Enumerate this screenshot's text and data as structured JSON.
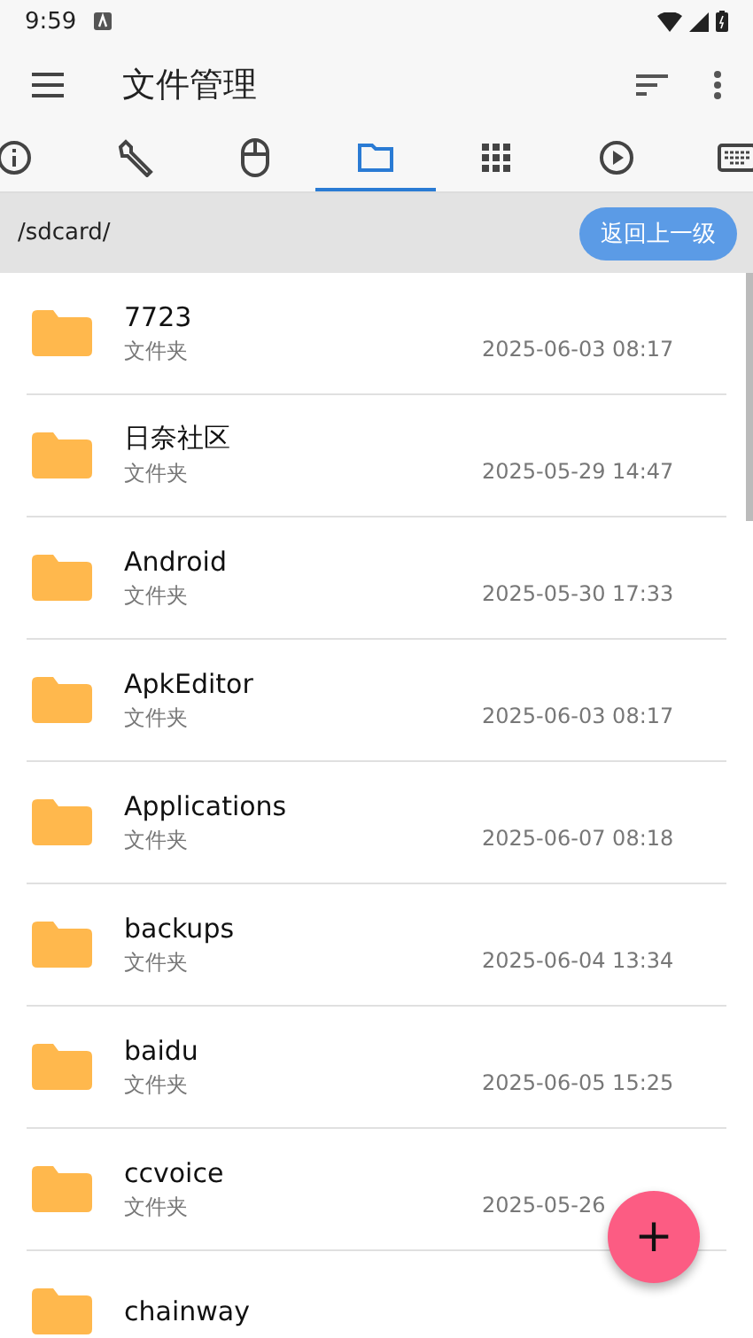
{
  "status_bar": {
    "time": "9:59"
  },
  "app_bar": {
    "title": "文件管理"
  },
  "tabs": [
    {
      "kind": "info",
      "selected": false
    },
    {
      "kind": "wrench",
      "selected": false
    },
    {
      "kind": "mouse",
      "selected": false
    },
    {
      "kind": "folder",
      "selected": true
    },
    {
      "kind": "grid",
      "selected": false
    },
    {
      "kind": "play",
      "selected": false
    },
    {
      "kind": "keyboard",
      "selected": false
    }
  ],
  "path_bar": {
    "path": "/sdcard/",
    "button": "返回上一级"
  },
  "files": [
    {
      "name": "7723",
      "type": "文件夹",
      "date": "2025-06-03 08:17"
    },
    {
      "name": "日奈社区",
      "type": "文件夹",
      "date": "2025-05-29 14:47"
    },
    {
      "name": "Android",
      "type": "文件夹",
      "date": "2025-05-30 17:33"
    },
    {
      "name": "ApkEditor",
      "type": "文件夹",
      "date": "2025-06-03 08:17"
    },
    {
      "name": "Applications",
      "type": "文件夹",
      "date": "2025-06-07 08:18"
    },
    {
      "name": "backups",
      "type": "文件夹",
      "date": "2025-06-04 13:34"
    },
    {
      "name": "baidu",
      "type": "文件夹",
      "date": "2025-06-05 15:25"
    },
    {
      "name": "ccvoice",
      "type": "文件夹",
      "date": "2025-05-26"
    },
    {
      "name": "chainway"
    }
  ],
  "fab": {
    "label": "+"
  }
}
